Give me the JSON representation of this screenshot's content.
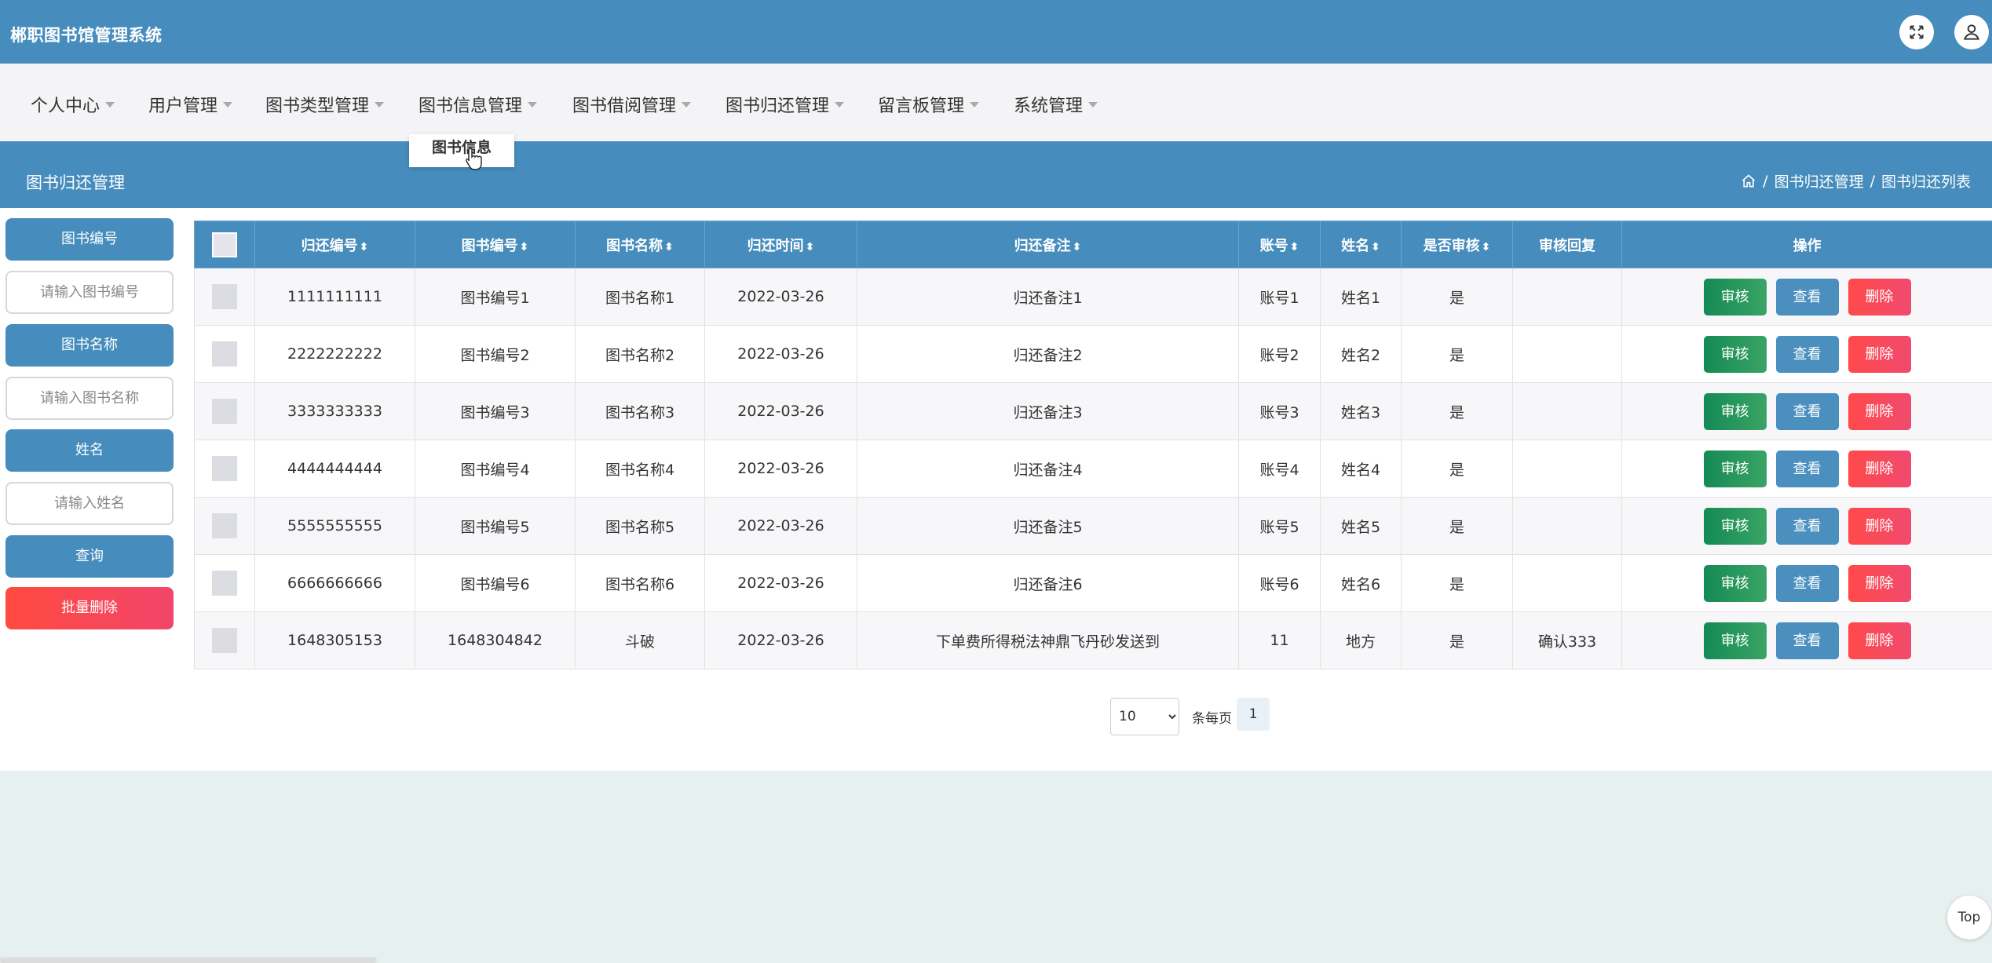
{
  "app": {
    "title": "郴职图书馆管理系统"
  },
  "header_icons": {
    "fullscreen": "expand-icon",
    "user": "user-icon"
  },
  "nav": {
    "items": [
      {
        "label": "个人中心"
      },
      {
        "label": "用户管理"
      },
      {
        "label": "图书类型管理"
      },
      {
        "label": "图书信息管理"
      },
      {
        "label": "图书借阅管理"
      },
      {
        "label": "图书归还管理"
      },
      {
        "label": "留言板管理"
      },
      {
        "label": "系统管理"
      }
    ],
    "open_dropdown": {
      "item": "图书信息"
    }
  },
  "section": {
    "title": "图书归还管理",
    "breadcrumb": {
      "sep": "/",
      "level1": "图书归还管理",
      "level2": "图书归还列表"
    }
  },
  "search": {
    "book_no_label": "图书编号",
    "book_no_placeholder": "请输入图书编号",
    "book_name_label": "图书名称",
    "book_name_placeholder": "请输入图书名称",
    "name_label": "姓名",
    "name_placeholder": "请输入姓名",
    "query_button": "查询",
    "batch_delete_button": "批量删除"
  },
  "table": {
    "columns": [
      "归还编号",
      "图书编号",
      "图书名称",
      "归还时间",
      "归还备注",
      "账号",
      "姓名",
      "是否审核",
      "审核回复",
      "操作"
    ],
    "sortable_marker": "⬍",
    "actions": {
      "audit": "审核",
      "view": "查看",
      "delete": "删除"
    },
    "rows": [
      {
        "return_no": "1111111111",
        "book_no": "图书编号1",
        "book_name": "图书名称1",
        "return_time": "2022-03-26",
        "remark": "归还备注1",
        "account": "账号1",
        "name": "姓名1",
        "audited": "是",
        "reply": ""
      },
      {
        "return_no": "2222222222",
        "book_no": "图书编号2",
        "book_name": "图书名称2",
        "return_time": "2022-03-26",
        "remark": "归还备注2",
        "account": "账号2",
        "name": "姓名2",
        "audited": "是",
        "reply": ""
      },
      {
        "return_no": "3333333333",
        "book_no": "图书编号3",
        "book_name": "图书名称3",
        "return_time": "2022-03-26",
        "remark": "归还备注3",
        "account": "账号3",
        "name": "姓名3",
        "audited": "是",
        "reply": ""
      },
      {
        "return_no": "4444444444",
        "book_no": "图书编号4",
        "book_name": "图书名称4",
        "return_time": "2022-03-26",
        "remark": "归还备注4",
        "account": "账号4",
        "name": "姓名4",
        "audited": "是",
        "reply": ""
      },
      {
        "return_no": "5555555555",
        "book_no": "图书编号5",
        "book_name": "图书名称5",
        "return_time": "2022-03-26",
        "remark": "归还备注5",
        "account": "账号5",
        "name": "姓名5",
        "audited": "是",
        "reply": ""
      },
      {
        "return_no": "6666666666",
        "book_no": "图书编号6",
        "book_name": "图书名称6",
        "return_time": "2022-03-26",
        "remark": "归还备注6",
        "account": "账号6",
        "name": "姓名6",
        "audited": "是",
        "reply": ""
      },
      {
        "return_no": "1648305153",
        "book_no": "1648304842",
        "book_name": "斗破",
        "return_time": "2022-03-26",
        "remark": "下单费所得税法神鼎飞丹砂发送到",
        "account": "11",
        "name": "地方",
        "audited": "是",
        "reply": "确认333"
      }
    ]
  },
  "pagination": {
    "page_size": "10",
    "page_size_options": [
      "10"
    ],
    "per_page_label": "条每页",
    "current_page": "1"
  },
  "top_button": "Top",
  "colors": {
    "primary": "#468dbd",
    "audit": "#1a8b58",
    "delete": "#ff4d5a",
    "background": "#e6f0ee"
  }
}
